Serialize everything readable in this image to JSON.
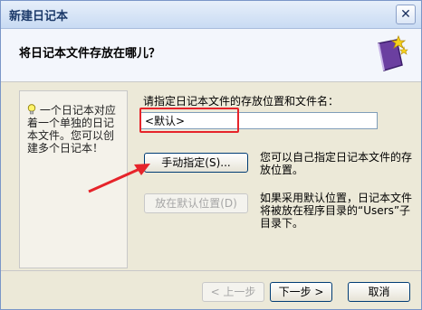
{
  "window": {
    "title": "新建日记本"
  },
  "header": {
    "title": "将日记本文件存放在哪儿？"
  },
  "tip": {
    "text": "一个日记本对应着一个单独的日记本文件。您可以创建多个日记本！"
  },
  "location": {
    "label": "请指定日记本文件的存放位置和文件名：",
    "value": "<默认>"
  },
  "manual": {
    "button_label": "手动指定(S)...",
    "description": "您可以自己指定日记本文件的存放位置。"
  },
  "default": {
    "button_label": "放在默认位置(D)",
    "description": "如果采用默认位置，日记本文件将被放在程序目录的“Users”子目录下。"
  },
  "footer": {
    "prev_label": "< 上一步",
    "next_label": "下一步 >",
    "cancel_label": "取消"
  },
  "colors": {
    "highlight": "#e6242a",
    "arrow": "#e6242a"
  },
  "icons": [
    "close-icon",
    "diary-book-icon",
    "lightbulb-icon",
    "arrow-annotation"
  ]
}
